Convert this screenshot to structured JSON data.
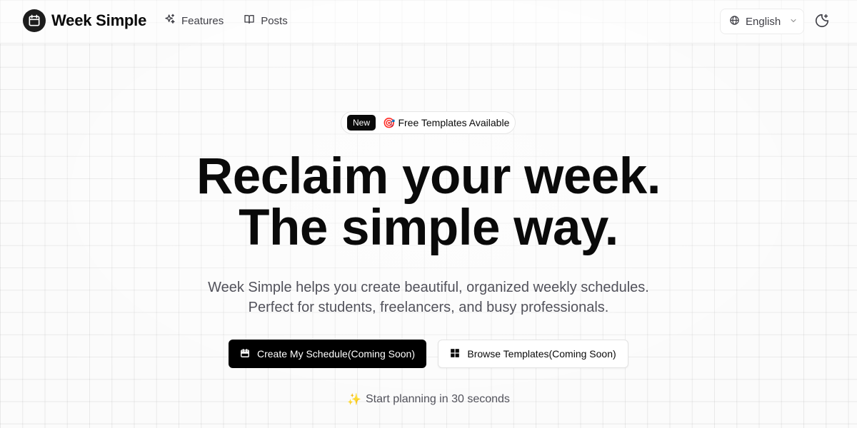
{
  "header": {
    "brand_name": "Week Simple",
    "nav": [
      {
        "label": "Features",
        "icon": "sparkles-icon"
      },
      {
        "label": "Posts",
        "icon": "book-open-icon"
      }
    ],
    "language": {
      "selected": "English",
      "icon": "globe-icon"
    },
    "theme_toggle_icon": "moon-star-icon"
  },
  "hero": {
    "badge": {
      "tag": "New",
      "emoji": "🎯",
      "text": "Free Templates Available"
    },
    "title_lines": [
      "Reclaim your week.",
      "The simple way."
    ],
    "subtitle_lines": [
      "Week Simple helps you create beautiful, organized weekly schedules.",
      "Perfect for students, freelancers, and busy professionals."
    ],
    "primary_button": {
      "label": "Create My Schedule(Coming Soon)",
      "icon": "calendar-icon"
    },
    "secondary_button": {
      "label": "Browse Templates(Coming Soon)",
      "icon": "grid-icon"
    },
    "tagline": {
      "emoji": "✨",
      "text": "Start planning in 30 seconds"
    }
  },
  "colors": {
    "background": "#fbfbfb",
    "primary": "#000000",
    "text": "#0a0a0a",
    "muted_text": "#52525b"
  }
}
